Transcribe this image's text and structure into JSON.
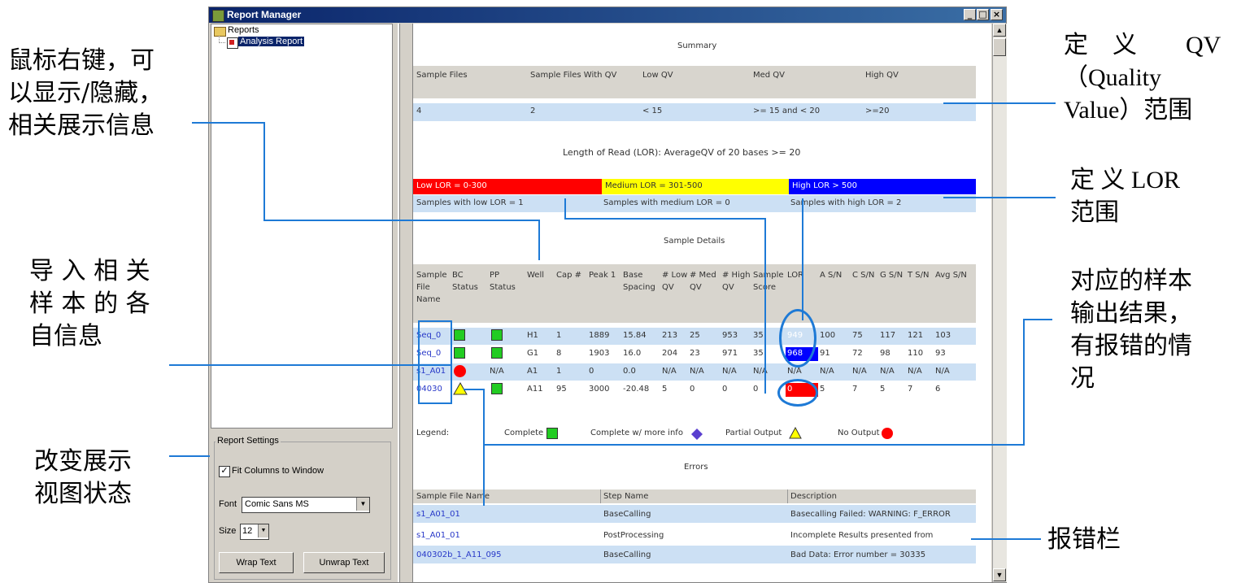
{
  "window": {
    "title": "Report Manager",
    "min": "_",
    "max": "□",
    "close": "×"
  },
  "tree": {
    "root": "Reports",
    "child": "Analysis Report"
  },
  "settings": {
    "group_label": "Report Settings",
    "fit_label": "Fit Columns to Window",
    "font_label": "Font",
    "font_value": "Comic Sans MS",
    "size_label": "Size",
    "size_value": "12",
    "wrap": "Wrap Text",
    "unwrap": "Unwrap Text"
  },
  "summary": {
    "title": "Summary",
    "headers": [
      "Sample Files",
      "Sample Files With QV",
      "Low QV",
      "Med QV",
      "High QV"
    ],
    "row": [
      "4",
      "2",
      "< 15",
      ">= 15 and < 20",
      ">=20"
    ]
  },
  "lor": {
    "title": "Length of Read (LOR): AverageQV of 20 bases >= 20",
    "bands": [
      "Low LOR = 0-300",
      "Medium LOR = 301-500",
      "High LOR > 500"
    ],
    "counts": [
      "Samples with low LOR = 1",
      "Samples with medium LOR = 0",
      "Samples with high LOR = 2"
    ],
    "colors": {
      "low": "#ff0000",
      "medium": "#ffff00",
      "high": "#0000ff"
    }
  },
  "details": {
    "title": "Sample Details",
    "headers": [
      "Sample File Name",
      "BC Status",
      "PP Status",
      "Well",
      "Cap #",
      "Peak 1",
      "Base Spacing",
      "# Low QV",
      "# Med QV",
      "# High QV",
      "Sample Score",
      "LOR",
      "A S/N",
      "C S/N",
      "G S/N",
      "T S/N",
      "Avg S/N"
    ],
    "rows": [
      [
        "Seq_0",
        "",
        "",
        "H1",
        "1",
        "1889",
        "15.84",
        "213",
        "25",
        "953",
        "35",
        "949",
        "100",
        "75",
        "117",
        "121",
        "103"
      ],
      [
        "Seq_0",
        "",
        "",
        "G1",
        "8",
        "1903",
        "16.0",
        "204",
        "23",
        "971",
        "35",
        "968",
        "91",
        "72",
        "98",
        "110",
        "93"
      ],
      [
        "s1_A01",
        "",
        "N/A",
        "A1",
        "1",
        "0",
        "0.0",
        "N/A",
        "N/A",
        "N/A",
        "N/A",
        "N/A",
        "N/A",
        "N/A",
        "N/A",
        "N/A",
        "N/A"
      ],
      [
        "04030",
        "",
        "",
        "A11",
        "95",
        "3000",
        "-20.48",
        "5",
        "0",
        "0",
        "0",
        "0",
        "5",
        "7",
        "5",
        "7",
        "6"
      ]
    ]
  },
  "legend": {
    "label": "Legend:",
    "complete": "Complete",
    "more": "Complete w/ more info",
    "partial": "Partial Output",
    "none": "No Output"
  },
  "errors": {
    "title": "Errors",
    "headers": [
      "Sample File Name",
      "Step Name",
      "Description"
    ],
    "rows": [
      [
        "s1_A01_01",
        "BaseCalling",
        "Basecalling Failed: WARNING: F_ERROR"
      ],
      [
        "s1_A01_01",
        "PostProcessing",
        "Incomplete Results presented from"
      ],
      [
        "040302b_1_A11_095",
        "BaseCalling",
        "Bad Data: Error number = 30335"
      ]
    ]
  },
  "annotations": {
    "left1": [
      "鼠标右键，可",
      "以显示/隐藏，",
      "相关展示信息"
    ],
    "left2": [
      "导 入 相 关",
      "样 本 的 各",
      "自信息"
    ],
    "left3": [
      "改变展示",
      "视图状态"
    ],
    "right1": [
      "定　义　　QV",
      "（Quality",
      "Value）范围"
    ],
    "right2": [
      "定 义 LOR",
      "范围"
    ],
    "right3": [
      "对应的样本",
      "输出结果，",
      "有报错的情",
      "况"
    ],
    "right4": "报错栏"
  }
}
